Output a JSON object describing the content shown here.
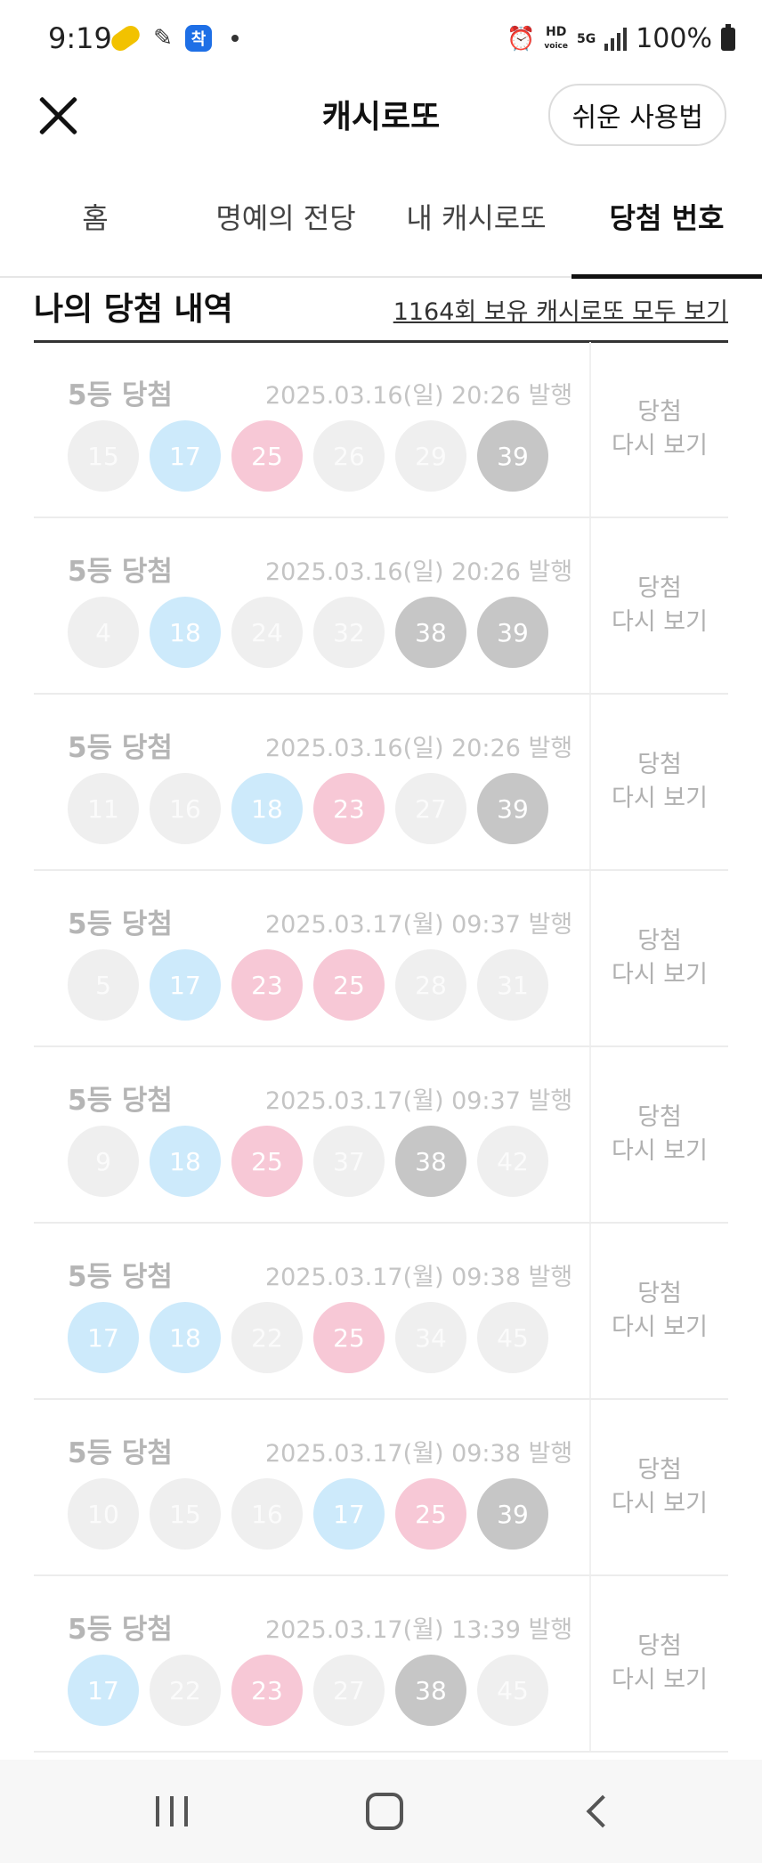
{
  "status_bar": {
    "time": "9:19",
    "app_badge": "착",
    "hd_label": "HD",
    "voice_label": "voice",
    "net_label": "5G",
    "battery": "100%"
  },
  "header": {
    "title": "캐시로또",
    "guide_button": "쉬운 사용법"
  },
  "tabs": [
    {
      "label": "홈",
      "active": false
    },
    {
      "label": "명예의 전당",
      "active": false
    },
    {
      "label": "내 캐시로또",
      "active": false
    },
    {
      "label": "당첨 번호",
      "active": true
    }
  ],
  "history": {
    "title": "나의 당첨 내역",
    "view_all": "1164회 보유 캐시로또 모두 보기"
  },
  "colors": {
    "blue_ball": "#cdeafb",
    "pink_ball": "#f7c8d6",
    "gray_ball": "#c6c6c6",
    "dim_ball": "#efefef"
  },
  "recheck": {
    "line1": "당첨",
    "line2": "다시 보기"
  },
  "tickets": [
    {
      "rank": "5등 당첨",
      "issued": "2025.03.16(일) 20:26 발행",
      "balls": [
        {
          "n": "15",
          "c": "dim"
        },
        {
          "n": "17",
          "c": "blue"
        },
        {
          "n": "25",
          "c": "pink"
        },
        {
          "n": "26",
          "c": "dim"
        },
        {
          "n": "29",
          "c": "dim"
        },
        {
          "n": "39",
          "c": "gray"
        }
      ]
    },
    {
      "rank": "5등 당첨",
      "issued": "2025.03.16(일) 20:26 발행",
      "balls": [
        {
          "n": "4",
          "c": "dim"
        },
        {
          "n": "18",
          "c": "blue"
        },
        {
          "n": "24",
          "c": "dim"
        },
        {
          "n": "32",
          "c": "dim"
        },
        {
          "n": "38",
          "c": "gray"
        },
        {
          "n": "39",
          "c": "gray"
        }
      ]
    },
    {
      "rank": "5등 당첨",
      "issued": "2025.03.16(일) 20:26 발행",
      "balls": [
        {
          "n": "11",
          "c": "dim"
        },
        {
          "n": "16",
          "c": "dim"
        },
        {
          "n": "18",
          "c": "blue"
        },
        {
          "n": "23",
          "c": "pink"
        },
        {
          "n": "27",
          "c": "dim"
        },
        {
          "n": "39",
          "c": "gray"
        }
      ]
    },
    {
      "rank": "5등 당첨",
      "issued": "2025.03.17(월) 09:37 발행",
      "balls": [
        {
          "n": "5",
          "c": "dim"
        },
        {
          "n": "17",
          "c": "blue"
        },
        {
          "n": "23",
          "c": "pink"
        },
        {
          "n": "25",
          "c": "pink"
        },
        {
          "n": "28",
          "c": "dim"
        },
        {
          "n": "31",
          "c": "dim"
        }
      ]
    },
    {
      "rank": "5등 당첨",
      "issued": "2025.03.17(월) 09:37 발행",
      "balls": [
        {
          "n": "9",
          "c": "dim"
        },
        {
          "n": "18",
          "c": "blue"
        },
        {
          "n": "25",
          "c": "pink"
        },
        {
          "n": "37",
          "c": "dim"
        },
        {
          "n": "38",
          "c": "gray"
        },
        {
          "n": "42",
          "c": "dim"
        }
      ]
    },
    {
      "rank": "5등 당첨",
      "issued": "2025.03.17(월) 09:38 발행",
      "balls": [
        {
          "n": "17",
          "c": "blue"
        },
        {
          "n": "18",
          "c": "blue"
        },
        {
          "n": "22",
          "c": "dim"
        },
        {
          "n": "25",
          "c": "pink"
        },
        {
          "n": "34",
          "c": "dim"
        },
        {
          "n": "45",
          "c": "dim"
        }
      ]
    },
    {
      "rank": "5등 당첨",
      "issued": "2025.03.17(월) 09:38 발행",
      "balls": [
        {
          "n": "10",
          "c": "dim"
        },
        {
          "n": "15",
          "c": "dim"
        },
        {
          "n": "16",
          "c": "dim"
        },
        {
          "n": "17",
          "c": "blue"
        },
        {
          "n": "25",
          "c": "pink"
        },
        {
          "n": "39",
          "c": "gray"
        }
      ]
    },
    {
      "rank": "5등 당첨",
      "issued": "2025.03.17(월) 13:39 발행",
      "balls": [
        {
          "n": "17",
          "c": "blue"
        },
        {
          "n": "22",
          "c": "dim"
        },
        {
          "n": "23",
          "c": "pink"
        },
        {
          "n": "27",
          "c": "dim"
        },
        {
          "n": "38",
          "c": "gray"
        },
        {
          "n": "45",
          "c": "dim"
        }
      ]
    }
  ],
  "nav_bar": {
    "recent_icon": "recent-apps-icon",
    "home_icon": "home-icon",
    "back_icon": "back-icon"
  }
}
